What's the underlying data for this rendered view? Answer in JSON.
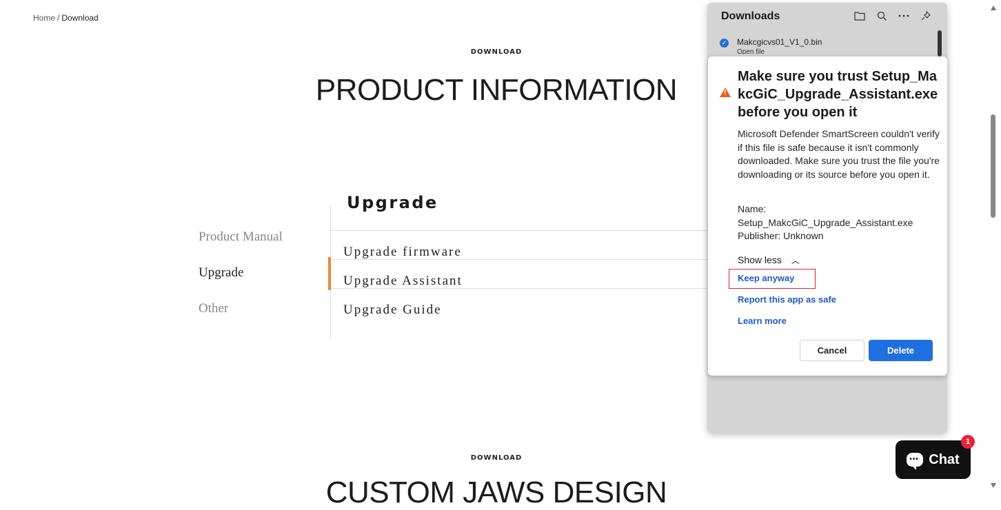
{
  "breadcrumb": {
    "home": "Home",
    "separator": "/",
    "current": "Download"
  },
  "hero": {
    "eyebrow": "DOWNLOAD",
    "title": "PRODUCT INFORMATION"
  },
  "side_nav": {
    "items": [
      {
        "label": "Product Manual",
        "state": "muted"
      },
      {
        "label": "Upgrade",
        "state": "active"
      },
      {
        "label": "Other",
        "state": "muted"
      }
    ]
  },
  "section": {
    "heading": "Upgrade",
    "rows": [
      {
        "label": "Upgrade firmware"
      },
      {
        "label": "Upgrade Assistant",
        "active": true
      },
      {
        "label": "Upgrade Guide"
      }
    ],
    "accent_color": "#e98a35"
  },
  "next_section": {
    "eyebrow": "DOWNLOAD",
    "title": "CUSTOM JAWS DESIGN"
  },
  "downloads": {
    "title": "Downloads",
    "toolbar_icons": [
      "folder-icon",
      "search-icon",
      "more-icon",
      "pin-icon"
    ],
    "file": {
      "name": "Makcgicvs01_V1_0.bin",
      "sub": "Open file"
    }
  },
  "warning": {
    "title": "Make sure you trust Setup_MakcGiC_Upgrade_Assistant.exe before you open it",
    "body": "Microsoft Defender SmartScreen couldn't verify if this file is safe because it isn't commonly downloaded. Make sure you trust the file you're downloading or its source before you open it.",
    "name_label": "Name:",
    "name_value": "Setup_MakcGiC_Upgrade_Assistant.exe",
    "publisher": "Publisher: Unknown",
    "show_less": "Show less",
    "keep_anyway": "Keep anyway",
    "report": "Report this app as safe",
    "learn_more": "Learn more",
    "cancel": "Cancel",
    "delete": "Delete",
    "delete_color": "#1f6fe0"
  },
  "chat": {
    "label": "Chat",
    "badge": "1"
  }
}
